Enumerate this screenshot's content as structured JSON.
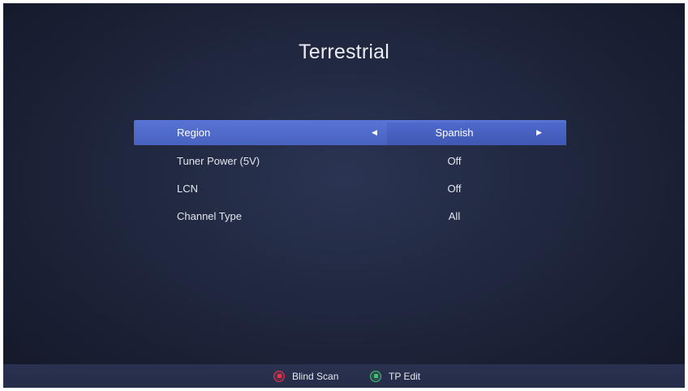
{
  "screen": {
    "title": "Terrestrial"
  },
  "menu": {
    "rows": [
      {
        "label": "Region",
        "value": "Spanish",
        "selected": true
      },
      {
        "label": "Tuner Power (5V)",
        "value": "Off",
        "selected": false
      },
      {
        "label": "LCN",
        "value": "Off",
        "selected": false
      },
      {
        "label": "Channel Type",
        "value": "All",
        "selected": false
      }
    ],
    "arrow_left_icon": "triangle-left-icon",
    "arrow_right_icon": "triangle-right-icon"
  },
  "footer": {
    "hints": [
      {
        "label": "Blind Scan",
        "icon": "red-button-icon",
        "color": "#e0364a"
      },
      {
        "label": "TP Edit",
        "icon": "green-button-icon",
        "color": "#3cc56b"
      }
    ]
  },
  "colors": {
    "selection": "#5270d2",
    "background": "#1f263c"
  }
}
